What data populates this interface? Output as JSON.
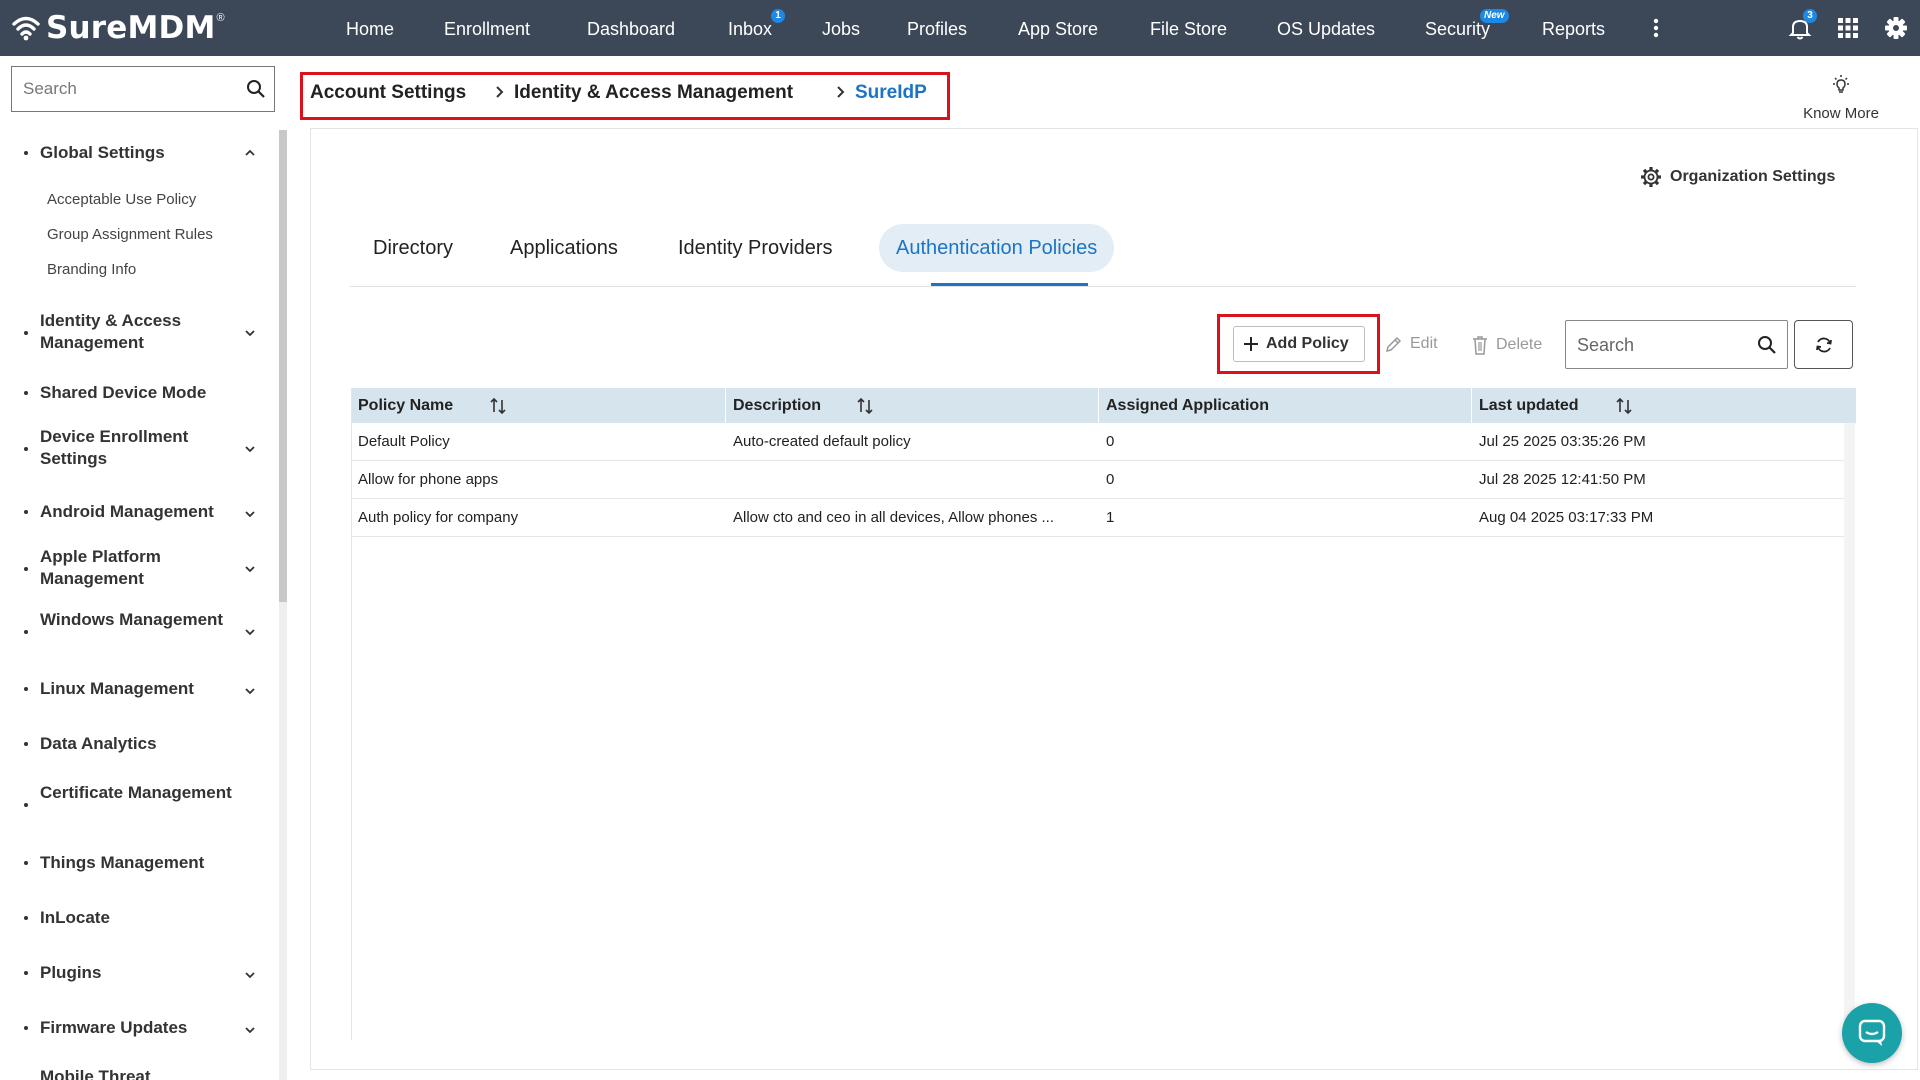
{
  "brand": {
    "name": "SureMDM",
    "reg": "®"
  },
  "nav": {
    "items": [
      {
        "label": "Home"
      },
      {
        "label": "Enrollment"
      },
      {
        "label": "Dashboard"
      },
      {
        "label": "Inbox",
        "badge": "1"
      },
      {
        "label": "Jobs"
      },
      {
        "label": "Profiles"
      },
      {
        "label": "App Store"
      },
      {
        "label": "File Store"
      },
      {
        "label": "OS Updates"
      },
      {
        "label": "Security",
        "badge": "New"
      },
      {
        "label": "Reports"
      }
    ],
    "notification_count": "3",
    "icons": [
      "more-vertical-icon",
      "bell-icon",
      "apps-grid-icon",
      "gear-icon"
    ]
  },
  "sidebar": {
    "search_placeholder": "Search",
    "items": [
      {
        "label": "Global Settings",
        "expanded": true
      },
      {
        "label": "Identity & Access Management"
      },
      {
        "label": "Shared Device Mode"
      },
      {
        "label": "Device Enrollment Settings"
      },
      {
        "label": "Android Management"
      },
      {
        "label": "Apple Platform Management"
      },
      {
        "label": "Windows Management"
      },
      {
        "label": "Linux Management"
      },
      {
        "label": "Data Analytics"
      },
      {
        "label": "Certificate Management"
      },
      {
        "label": "Things Management"
      },
      {
        "label": "InLocate"
      },
      {
        "label": "Plugins"
      },
      {
        "label": "Firmware Updates"
      },
      {
        "label": "Mobile Threat"
      }
    ],
    "sub_items": [
      "Acceptable Use Policy",
      "Group Assignment Rules",
      "Branding Info"
    ]
  },
  "breadcrumb": [
    "Account Settings",
    "Identity & Access Management",
    "SureIdP"
  ],
  "know_more": "Know More",
  "org_settings": "Organization Settings",
  "tabs": [
    {
      "label": "Directory"
    },
    {
      "label": "Applications"
    },
    {
      "label": "Identity Providers"
    },
    {
      "label": "Authentication Policies",
      "active": true
    }
  ],
  "toolbar": {
    "add_label": "Add Policy",
    "edit_label": "Edit",
    "delete_label": "Delete",
    "search_placeholder": "Search"
  },
  "table": {
    "columns": [
      "Policy Name",
      "Description",
      "Assigned Application",
      "Last updated"
    ],
    "rows": [
      [
        "Default Policy",
        "Auto-created default policy",
        "0",
        "Jul 25 2025 03:35:26 PM"
      ],
      [
        "Allow for phone apps",
        "",
        "0",
        "Jul 28 2025 12:41:50 PM"
      ],
      [
        "Auth policy for company",
        "Allow cto and ceo in all devices, Allow phones ...",
        "1",
        "Aug 04 2025 03:17:33 PM"
      ]
    ]
  },
  "colors": {
    "topbar": "#3c4757",
    "accent": "#1b74c5",
    "highlight": "#d9131e",
    "table_header": "#d6e4ee",
    "chat": "#1aa2a8"
  }
}
